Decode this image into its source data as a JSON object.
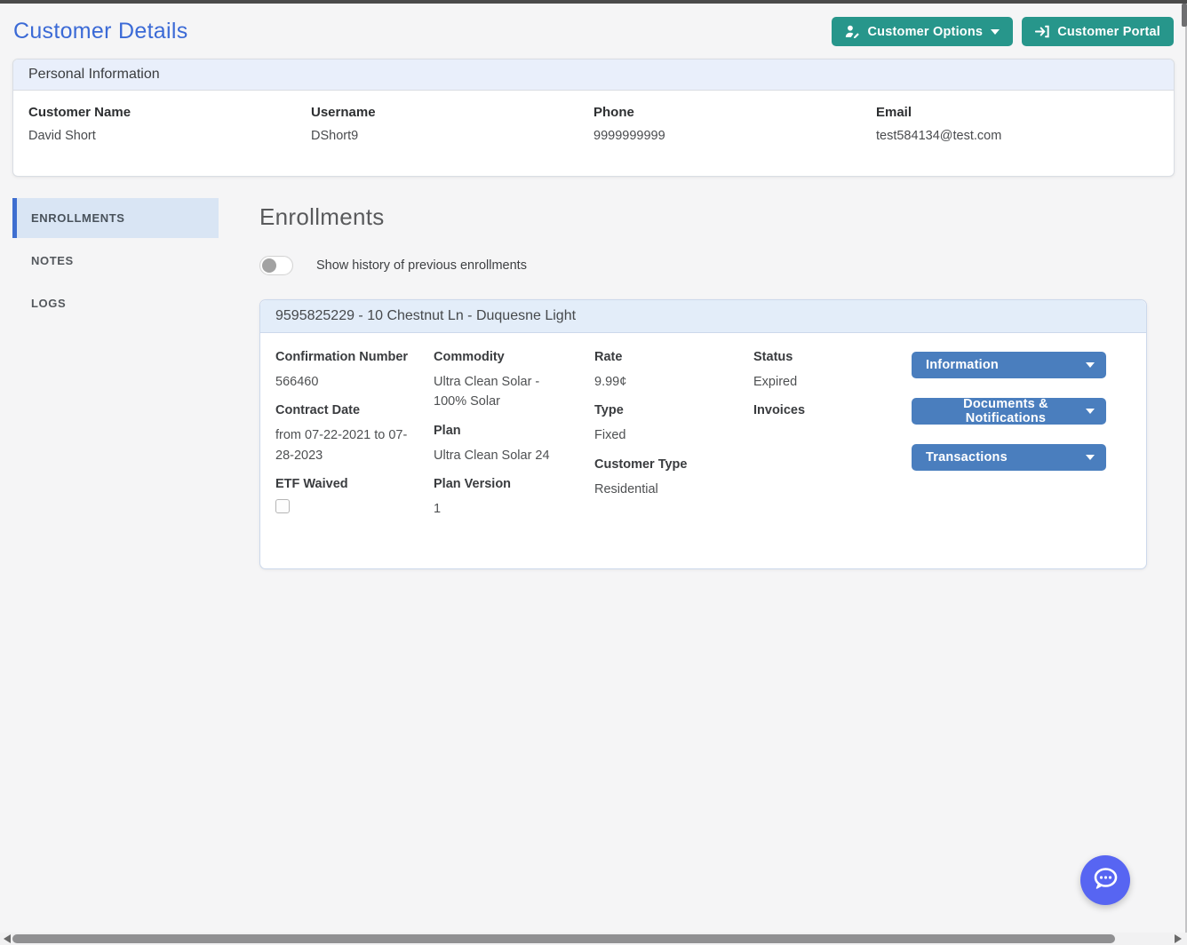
{
  "page": {
    "title": "Customer Details"
  },
  "header": {
    "buttons": [
      {
        "label": "Customer Options",
        "icon": "user-edit-icon",
        "has_caret": true
      },
      {
        "label": "Customer Portal",
        "icon": "sign-in-icon",
        "has_caret": false
      }
    ],
    "button_color": "#27968b"
  },
  "personal_info": {
    "title": "Personal Information",
    "fields": [
      {
        "label": "Customer Name",
        "value": "David Short"
      },
      {
        "label": "Username",
        "value": "DShort9"
      },
      {
        "label": "Phone",
        "value": "9999999999"
      },
      {
        "label": "Email",
        "value": "test584134@test.com"
      }
    ]
  },
  "sidebar": {
    "items": [
      {
        "label": "ENROLLMENTS",
        "active": true
      },
      {
        "label": "NOTES",
        "active": false
      },
      {
        "label": "LOGS",
        "active": false
      }
    ],
    "active_border_color": "#3e6ed0"
  },
  "enrollments": {
    "heading": "Enrollments",
    "history_toggle": {
      "label": "Show history of previous enrollments",
      "state": "off"
    },
    "card": {
      "header": "9595825229 - 10 Chestnut Ln - Duquesne Light",
      "col1": [
        {
          "label": "Confirmation Number",
          "value": "566460"
        },
        {
          "label": "Contract Date",
          "value": "from 07-22-2021 to 07-28-2023"
        },
        {
          "label": "ETF Waived",
          "value": "",
          "control": "checkbox",
          "checked": false
        }
      ],
      "col2": [
        {
          "label": "Commodity",
          "value": "Ultra Clean Solar - 100% Solar"
        },
        {
          "label": "Plan",
          "value": "Ultra Clean Solar 24"
        },
        {
          "label": "Plan Version",
          "value": "1"
        }
      ],
      "col3": [
        {
          "label": "Rate",
          "value": "9.99¢"
        },
        {
          "label": "Type",
          "value": "Fixed"
        },
        {
          "label": "Customer Type",
          "value": "Residential"
        }
      ],
      "col4": [
        {
          "label": "Status",
          "value": "Expired"
        },
        {
          "label": "Invoices",
          "value": ""
        }
      ],
      "actions": [
        {
          "label": "Information",
          "icon": "caret-down-icon"
        },
        {
          "label": "Documents & Notifications",
          "icon": "caret-down-icon"
        },
        {
          "label": "Transactions",
          "icon": "caret-down-icon"
        }
      ],
      "action_color": "#4a7ebe"
    }
  },
  "chat": {
    "icon": "chat-bubble-icon",
    "color": "#5765f2"
  }
}
